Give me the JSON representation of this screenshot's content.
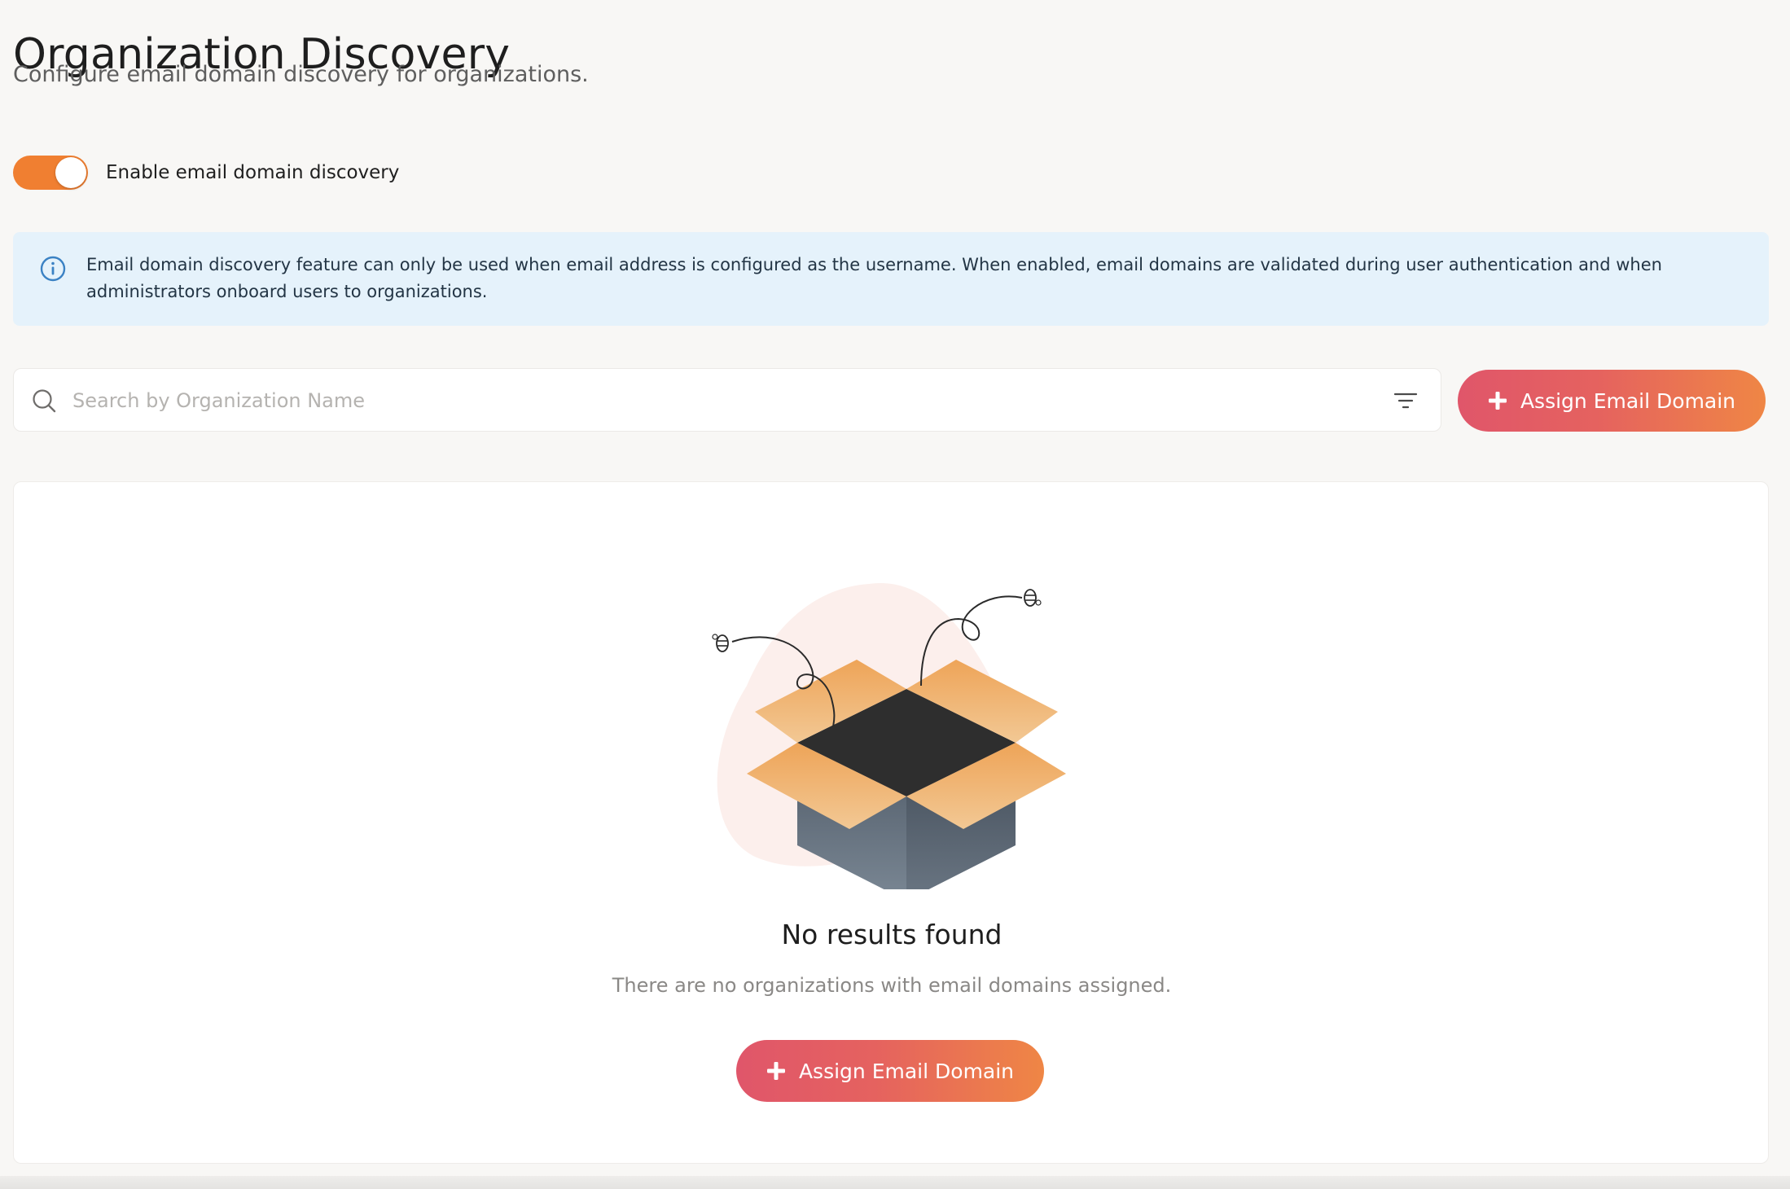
{
  "header": {
    "title": "Organization Discovery",
    "subtitle": "Configure email domain discovery for organizations."
  },
  "toggle": {
    "label": "Enable email domain discovery",
    "enabled": true
  },
  "info": {
    "icon": "info-icon",
    "text": "Email domain discovery feature can only be used when email address is configured as the username. When enabled, email domains are validated during user authentication and when administrators onboard users to organizations."
  },
  "search": {
    "placeholder": "Search by Organization Name",
    "value": ""
  },
  "actions": {
    "assign_label": "Assign Email Domain"
  },
  "empty_state": {
    "title": "No results found",
    "description": "There are no organizations with email domains assigned.",
    "button_label": "Assign Email Domain"
  },
  "colors": {
    "accent": "#f07f31",
    "button_gradient_start": "#e0566a",
    "button_gradient_end": "#ef8645",
    "info_background": "#e5f2fb"
  }
}
